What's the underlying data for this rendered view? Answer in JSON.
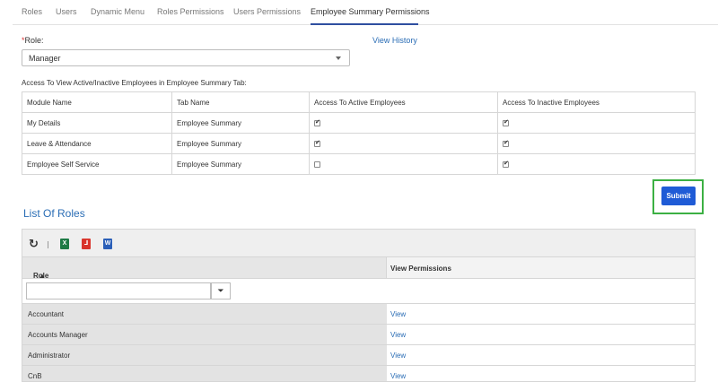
{
  "tabs": [
    "Roles",
    "Users",
    "Dynamic Menu",
    "Roles Permissions",
    "Users Permissions",
    "Employee Summary Permissions"
  ],
  "role": {
    "required_mark": "*",
    "label": "Role:",
    "selected": "Manager",
    "view_history": "View History"
  },
  "access_heading": "Access To View Active/Inactive Employees in Employee Summary Tab:",
  "perm_table": {
    "headers": [
      "Module Name",
      "Tab Name",
      "Access To Active Employees",
      "Access To Inactive Employees"
    ],
    "rows": [
      {
        "module": "My Details",
        "tab": "Employee Summary",
        "active": true,
        "inactive": true
      },
      {
        "module": "Leave & Attendance",
        "tab": "Employee Summary",
        "active": true,
        "inactive": true
      },
      {
        "module": "Employee Self Service",
        "tab": "Employee Summary",
        "active": false,
        "inactive": true
      }
    ]
  },
  "submit_label": "Submit",
  "accent_color": "#1f5bd6",
  "highlight_color": "#3cb043",
  "list_of_roles": {
    "title": "List Of Roles",
    "toolbar_icons": [
      "refresh-icon",
      "excel-icon",
      "pdf-icon",
      "word-icon"
    ],
    "col_role": "Role",
    "col_perm": "View Permissions",
    "rows": [
      {
        "role": "Accountant",
        "link": "View"
      },
      {
        "role": "Accounts Manager",
        "link": "View"
      },
      {
        "role": "Administrator",
        "link": "View"
      },
      {
        "role": "CnB",
        "link": "View"
      }
    ]
  }
}
